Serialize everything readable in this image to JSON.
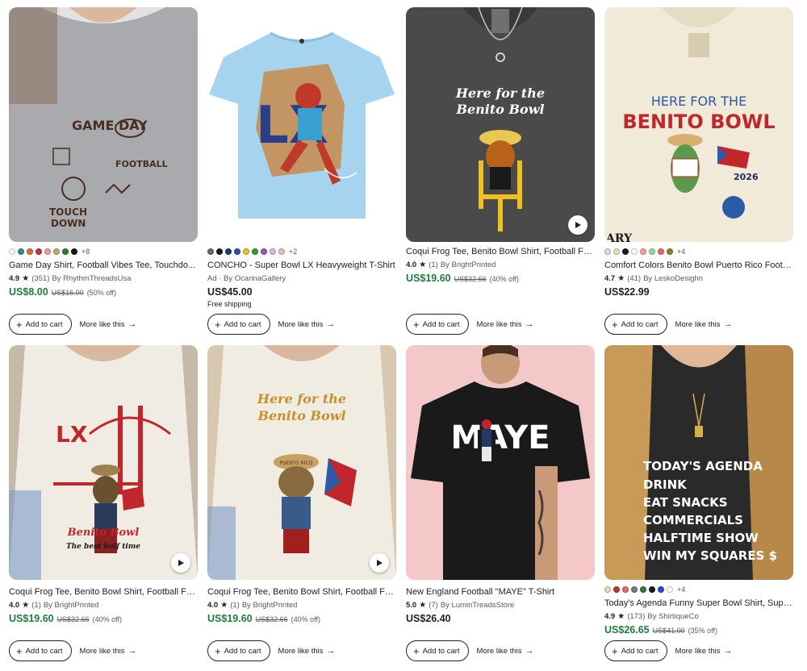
{
  "products": [
    {
      "title": "Game Day Shirt, Football Vibes Tee, Touchdo...",
      "ad": "",
      "rating": "4.9",
      "reviews": "(351)",
      "seller": "By RhythmThreadsUsa",
      "price": "US$8.00",
      "original_price": "US$16.00",
      "discount": "(50% off)",
      "sale": true,
      "shipping": "",
      "swatches": [
        "#ffffff",
        "#3a8a8a",
        "#e06a3a",
        "#c0392b",
        "#e8a0a0",
        "#c9a66b",
        "#2e7d32",
        "#1a1a1a"
      ],
      "more_colors": "+8",
      "video": false,
      "image_text": [
        "GAME DAY",
        "FOOTBALL",
        "TOUCH",
        "DOWN"
      ]
    },
    {
      "title": "CONCHO - Super Bowl LX Heavyweight T-Shirt",
      "ad": "Ad · By OcarinaGallery",
      "rating": "",
      "reviews": "",
      "seller": "",
      "price": "US$45.00",
      "original_price": "",
      "discount": "",
      "sale": false,
      "shipping": "Free shipping",
      "swatches": [
        "#6b6b6b",
        "#1a1a1a",
        "#1f3a6b",
        "#2a4fa0",
        "#e8c020",
        "#2e9e3a",
        "#9b59b6",
        "#d8b8e8",
        "#f0b8c8"
      ],
      "more_colors": "+2",
      "video": false,
      "image_text": [
        "LX"
      ]
    },
    {
      "title": "Coqui Frog Tee, Benito Bowl Shirt, Football Fa...",
      "ad": "",
      "rating": "4.0",
      "reviews": "(1)",
      "seller": "By BrightPrinted",
      "price": "US$19.60",
      "original_price": "US$32.66",
      "discount": "(40% off)",
      "sale": true,
      "shipping": "",
      "swatches": [],
      "more_colors": "",
      "video": true,
      "image_text": [
        "Here for the",
        "Benito Bowl"
      ]
    },
    {
      "title": "Comfort Colors Benito Bowl Puerto Rico Footb...",
      "ad": "",
      "rating": "4.7",
      "reviews": "(41)",
      "seller": "By LeskoDesighn",
      "price": "US$22.99",
      "original_price": "",
      "discount": "",
      "sale": false,
      "shipping": "",
      "swatches": [
        "#c8e0f0",
        "#e8e0b0",
        "#1a1a1a",
        "#ffffff",
        "#f4a0a0",
        "#90e0a0",
        "#e86a6a",
        "#7a8a2a"
      ],
      "more_colors": "+4",
      "video": false,
      "image_text": [
        "HERE FOR THE",
        "BENITO BOWL",
        "2026",
        "ARY"
      ]
    },
    {
      "title": "Coqui Frog Tee, Benito Bowl Shirt, Football Fa...",
      "ad": "",
      "rating": "4.0",
      "reviews": "(1)",
      "seller": "By BrightPrinted",
      "price": "US$19.60",
      "original_price": "US$32.66",
      "discount": "(40% off)",
      "sale": true,
      "shipping": "",
      "swatches": [],
      "more_colors": "",
      "video": true,
      "image_text": [
        "LX",
        "Benito Bowl",
        "The best half time"
      ]
    },
    {
      "title": "Coqui Frog Tee, Benito Bowl Shirt, Football Fa...",
      "ad": "",
      "rating": "4.0",
      "reviews": "(1)",
      "seller": "By BrightPrinted",
      "price": "US$19.60",
      "original_price": "US$32.66",
      "discount": "(40% off)",
      "sale": true,
      "shipping": "",
      "swatches": [],
      "more_colors": "",
      "video": true,
      "image_text": [
        "Here for the",
        "Benito Bowl",
        "PUERTO RICO"
      ]
    },
    {
      "title": "New England Football \"MAYE\" T-Shirt",
      "ad": "",
      "rating": "5.0",
      "reviews": "(7)",
      "seller": "By LuminTreadsStore",
      "price": "US$26.40",
      "original_price": "",
      "discount": "",
      "sale": false,
      "shipping": "",
      "swatches": [],
      "more_colors": "",
      "video": false,
      "image_text": [
        "MAYE"
      ]
    },
    {
      "title": "Today's Agenda Funny Super Bowl Shirt, Supe...",
      "ad": "",
      "rating": "4.9",
      "reviews": "(173)",
      "seller": "By ShirtiqueCo",
      "price": "US$26.65",
      "original_price": "US$41.00",
      "discount": "(35% off)",
      "sale": true,
      "shipping": "",
      "swatches": [
        "#e8d8b8",
        "#c0392b",
        "#e86a6a",
        "#7a7a7a",
        "#2e7d32",
        "#1a1a1a",
        "#1f4fd0",
        "#ffffff"
      ],
      "more_colors": "+4",
      "video": false,
      "image_text": [
        "TODAY'S AGENDA",
        "DRINK",
        "EAT SNACKS",
        "COMMERCIALS",
        "HALFTIME SHOW",
        "WIN MY SQUARES $"
      ]
    }
  ],
  "labels": {
    "add_to_cart": "Add to cart",
    "more_like_this": "More like this"
  },
  "colors": {
    "sale_green": "#1b7f3b",
    "text": "#222222",
    "muted": "#595959"
  }
}
